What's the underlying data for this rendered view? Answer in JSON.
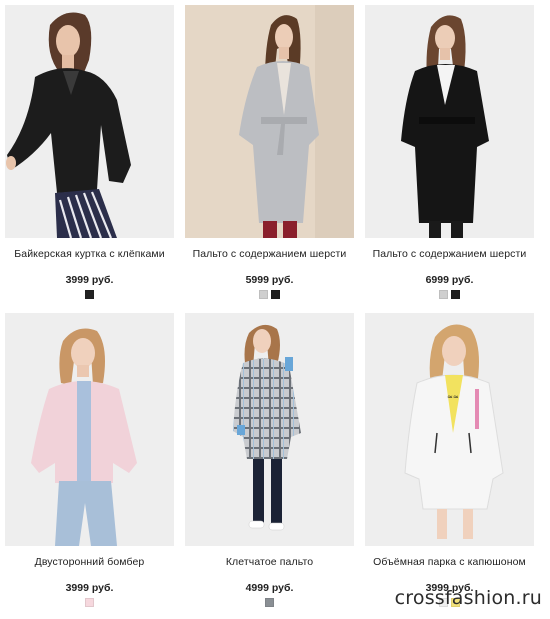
{
  "products": [
    {
      "title": "Байкерская куртка с клёпками",
      "price": "3999 руб.",
      "colors": [
        "#222222"
      ],
      "photo_bg": "#eeeeee"
    },
    {
      "title": "Пальто с содержанием шерсти",
      "price": "5999 руб.",
      "colors": [
        "#cfcfcf",
        "#1e1e1e"
      ],
      "photo_bg": "#e5d7c6"
    },
    {
      "title": "Пальто с содержанием шерсти",
      "price": "6999 руб.",
      "colors": [
        "#cfcfcf",
        "#1e1e1e"
      ],
      "photo_bg": "#eeeeee"
    },
    {
      "title": "Двусторонний бомбер",
      "price": "3999 руб.",
      "colors": [
        "#f6d8de"
      ],
      "photo_bg": "#eeeeee"
    },
    {
      "title": "Клетчатое пальто",
      "price": "4999 руб.",
      "colors": [
        "#8a8f94"
      ],
      "photo_bg": "#eeeeee"
    },
    {
      "title": "Объёмная парка с капюшоном",
      "price": "3999 руб.",
      "colors": [
        "#f0f0f0",
        "#f3e27a"
      ],
      "photo_bg": "#eeeeee"
    }
  ],
  "watermark": "crossfashion.ru"
}
